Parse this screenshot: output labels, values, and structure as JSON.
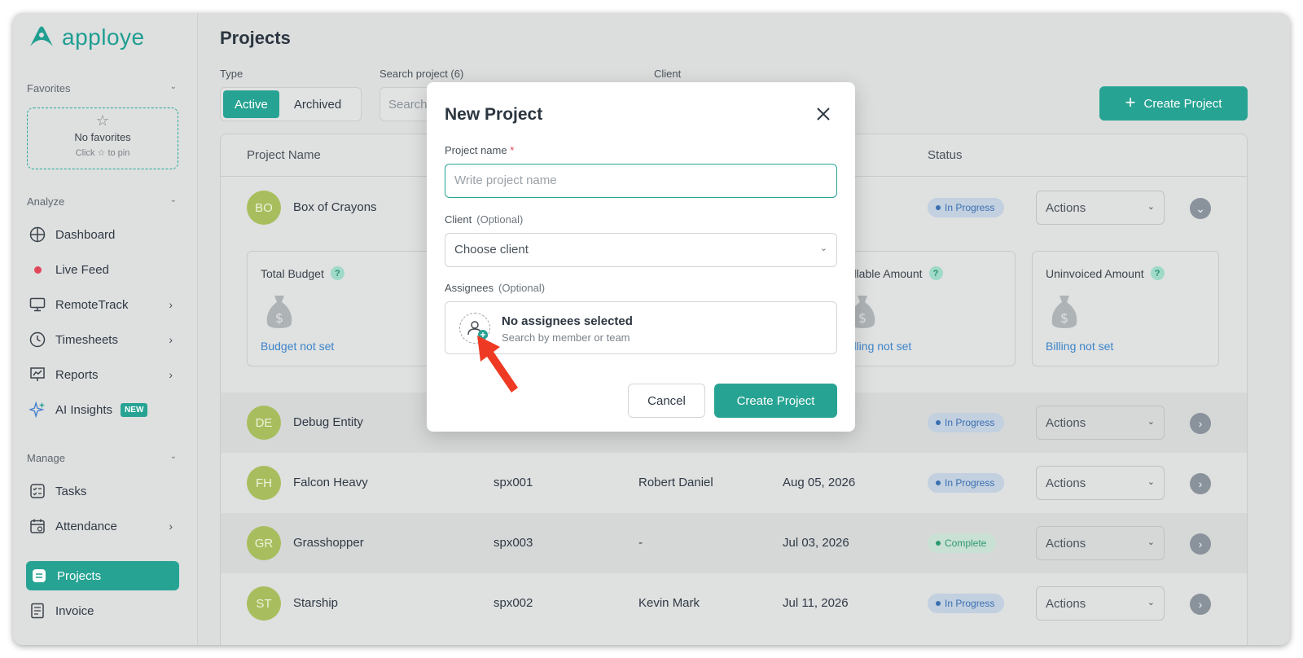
{
  "app": {
    "name": "apploye",
    "brand_color": "#27a393"
  },
  "sidebar": {
    "favorites_label": "Favorites",
    "favorites_empty_title": "No favorites",
    "favorites_empty_hint": "Click ☆ to pin",
    "analyze_label": "Analyze",
    "manage_label": "Manage",
    "items": [
      {
        "label": "Dashboard",
        "icon": "dashboard-icon"
      },
      {
        "label": "Live Feed",
        "icon": "live-dot-icon"
      },
      {
        "label": "RemoteTrack",
        "icon": "monitor-icon"
      },
      {
        "label": "Timesheets",
        "icon": "clock-icon"
      },
      {
        "label": "Reports",
        "icon": "chart-icon"
      },
      {
        "label": "AI Insights",
        "icon": "sparkle-icon",
        "badge": "NEW"
      },
      {
        "label": "Tasks",
        "icon": "tasks-icon"
      },
      {
        "label": "Attendance",
        "icon": "calendar-icon"
      },
      {
        "label": "Projects",
        "icon": "projects-icon",
        "active": true
      },
      {
        "label": "Invoice",
        "icon": "invoice-icon"
      }
    ]
  },
  "main": {
    "title": "Projects",
    "type_label": "Type",
    "type_options": [
      "Active",
      "Archived"
    ],
    "search_label": "Search project (6)",
    "search_placeholder": "Search",
    "client_label": "Client",
    "create_button": "Create Project",
    "columns": {
      "name": "Project Name",
      "status": "Status"
    },
    "rows": [
      {
        "initials": "BO",
        "name": "Box of Crayons",
        "code": "",
        "client": "",
        "date": "",
        "status": "In Progress",
        "actions": "Actions"
      },
      {
        "initials": "DE",
        "name": "Debug Entity",
        "code": "",
        "client": "",
        "date": "",
        "status": "In Progress",
        "actions": "Actions"
      },
      {
        "initials": "FH",
        "name": "Falcon Heavy",
        "code": "spx001",
        "client": "Robert Daniel",
        "date": "Aug 05, 2026",
        "status": "In Progress",
        "actions": "Actions"
      },
      {
        "initials": "GR",
        "name": "Grasshopper",
        "code": "spx003",
        "client": "-",
        "date": "Jul 03, 2026",
        "status": "Complete",
        "actions": "Actions"
      },
      {
        "initials": "ST",
        "name": "Starship",
        "code": "spx002",
        "client": "Kevin Mark",
        "date": "Jul 11, 2026",
        "status": "In Progress",
        "actions": "Actions"
      }
    ],
    "cards": [
      {
        "title": "Total Budget",
        "link": "Budget not set"
      },
      {
        "title": "Billable Amount",
        "link": "Billing not set"
      },
      {
        "title": "Uninvoiced Amount",
        "link": "Billing not set"
      }
    ]
  },
  "modal": {
    "title": "New Project",
    "project_name_label": "Project name",
    "required_mark": "*",
    "project_name_placeholder": "Write project name",
    "client_label": "Client",
    "client_optional": "(Optional)",
    "client_placeholder": "Choose client",
    "assignees_label": "Assignees",
    "assignees_optional": "(Optional)",
    "assignees_title": "No assignees selected",
    "assignees_hint": "Search by member or team",
    "cancel": "Cancel",
    "create": "Create Project"
  }
}
